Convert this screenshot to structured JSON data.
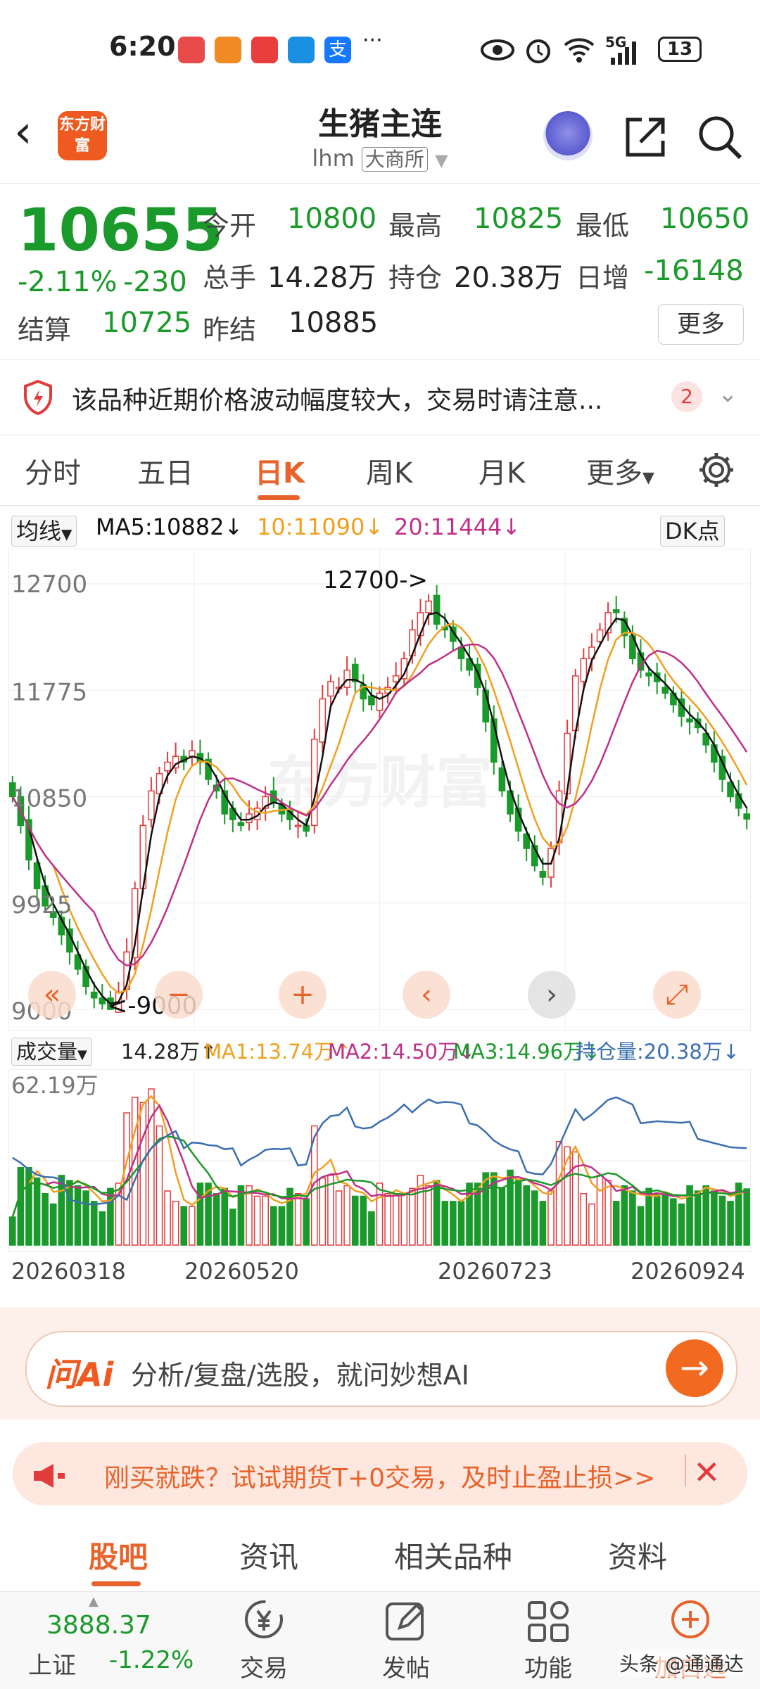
{
  "status_bar": {
    "time": "6:20",
    "dots": "···",
    "network": "5G",
    "battery": "13"
  },
  "header": {
    "logo_text": "东方财富",
    "title": "生猪主连",
    "code": "lhm",
    "exchange": "大商所"
  },
  "quote": {
    "price": "10655",
    "change_pct": "-2.11%",
    "change": "-230",
    "open_label": "今开",
    "open": "10800",
    "high_label": "最高",
    "high": "10825",
    "low_label": "最低",
    "low": "10650",
    "volume_label": "总手",
    "volume": "14.28万",
    "oi_label": "持仓",
    "oi": "20.38万",
    "daily_label": "日增",
    "daily": "-16148",
    "settle_label": "结算",
    "settle": "10725",
    "prev_settle_label": "昨结",
    "prev_settle": "10885",
    "more_label": "更多"
  },
  "notice": {
    "text": "该品种近期价格波动幅度较大，交易时请注意...",
    "badge": "2"
  },
  "tabs": [
    "分时",
    "五日",
    "日K",
    "周K",
    "月K",
    "更多"
  ],
  "ma_row": {
    "selector": "均线",
    "ma5": "MA5:10882↓",
    "ma10": "10:11090↓",
    "ma20": "20:11444↓",
    "dk": "DK点"
  },
  "colors": {
    "accent": "#e8632b",
    "up": "#e23b3b",
    "down": "#1a9a2a",
    "ma5": "#111111",
    "ma10": "#f0a020",
    "ma20": "#c0308a",
    "oi_line": "#3a6fb0"
  },
  "chart_labels": {
    "y_ticks": [
      "12700",
      "11775",
      "10850",
      "9925",
      "9000"
    ],
    "high_marker": "12700->",
    "low_marker": "<-9000"
  },
  "controls": [
    "«",
    "−",
    "+",
    "‹",
    "›",
    "⤢"
  ],
  "volume_row": {
    "selector": "成交量",
    "vol": "14.28万↑",
    "ma1": "MA1:13.74万↑",
    "ma2": "MA2:14.50万↓",
    "ma3": "MA3:14.96万↓",
    "oi": "持仓量:20.38万↓",
    "max_label": "62.19万"
  },
  "dates": [
    "20260318",
    "20260520",
    "20260723",
    "20260924"
  ],
  "chart_data": {
    "type": "candlestick",
    "title": "",
    "ylim": [
      9000,
      12700
    ],
    "grid": true,
    "series": [
      {
        "name": "MA5",
        "values": []
      },
      {
        "name": "10",
        "values": []
      },
      {
        "name": "20",
        "values": []
      }
    ],
    "close": [
      10850,
      10600,
      10300,
      10050,
      9900,
      9800,
      9650,
      9500,
      9350,
      9200,
      9100,
      9050,
      9000,
      9150,
      9500,
      10050,
      10600,
      10900,
      11050,
      11150,
      11200,
      11150,
      11250,
      11150,
      11000,
      10900,
      10700,
      10650,
      10600,
      10700,
      10750,
      10850,
      10800,
      10700,
      10650,
      10600,
      10550,
      11350,
      11700,
      11850,
      11800,
      11950,
      11850,
      11700,
      11650,
      11750,
      11800,
      11900,
      12050,
      12300,
      12450,
      12550,
      12350,
      12300,
      12200,
      12050,
      11950,
      11800,
      11500,
      11150,
      10900,
      10700,
      10550,
      10400,
      10250,
      10150,
      10400,
      10900,
      11400,
      11900,
      12050,
      12150,
      12300,
      12450,
      12450,
      12250,
      12050,
      11950,
      11900,
      11850,
      11750,
      11650,
      11550,
      11500,
      11450,
      11300,
      11150,
      11000,
      10850,
      10750,
      10655
    ],
    "volume_unit": "万",
    "volume_max": "62.19万"
  },
  "ai_bar": {
    "logo": "问Ai",
    "text": "分析/复盘/选股，就问妙想AI"
  },
  "promo": {
    "text": "刚买就跌？试试期货T+0交易，及时止盈止损>>"
  },
  "bottom_tabs": [
    "股吧",
    "资讯",
    "相关品种",
    "资料"
  ],
  "nav": {
    "index_value": "3888.37",
    "index_name": "上证",
    "index_change": "-1.22%",
    "items": [
      "交易",
      "发帖",
      "功能",
      "加自选"
    ],
    "watermark": "头条 @通通达"
  }
}
